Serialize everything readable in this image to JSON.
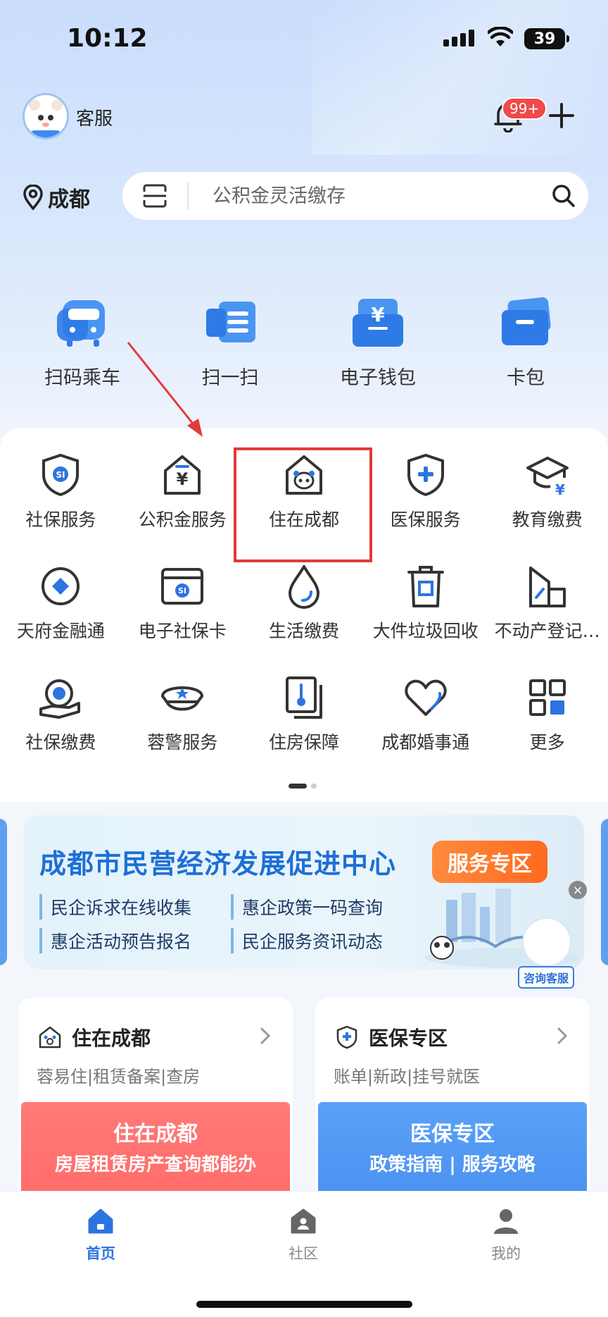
{
  "status_bar": {
    "time": "10:12",
    "battery": "39"
  },
  "header": {
    "service_label": "客服",
    "badge": "99+"
  },
  "location": {
    "city": "成都"
  },
  "search": {
    "placeholder": "公积金灵活缴存"
  },
  "quick_actions": [
    {
      "label": "扫码乘车",
      "icon": "bus-icon"
    },
    {
      "label": "扫一扫",
      "icon": "scan-icon"
    },
    {
      "label": "电子钱包",
      "icon": "wallet-icon"
    },
    {
      "label": "卡包",
      "icon": "card-icon"
    }
  ],
  "services": [
    {
      "label": "社保服务",
      "icon": "social-security-shield-icon"
    },
    {
      "label": "公积金服务",
      "icon": "housing-fund-house-icon"
    },
    {
      "label": "住在成都",
      "icon": "panda-house-icon"
    },
    {
      "label": "医保服务",
      "icon": "medical-shield-icon"
    },
    {
      "label": "教育缴费",
      "icon": "education-cap-icon"
    },
    {
      "label": "天府金融通",
      "icon": "diamond-circle-icon"
    },
    {
      "label": "电子社保卡",
      "icon": "social-card-icon"
    },
    {
      "label": "生活缴费",
      "icon": "water-drop-icon"
    },
    {
      "label": "大件垃圾回收",
      "icon": "trash-bin-icon"
    },
    {
      "label": "不动产登记…",
      "icon": "property-building-icon"
    },
    {
      "label": "社保缴费",
      "icon": "social-pay-icon"
    },
    {
      "label": "蓉警服务",
      "icon": "police-cap-icon"
    },
    {
      "label": "住房保障",
      "icon": "housing-thermometer-icon"
    },
    {
      "label": "成都婚事通",
      "icon": "heart-icon"
    },
    {
      "label": "更多",
      "icon": "more-grid-icon"
    }
  ],
  "banner": {
    "title": "成都市民营经济发展促进中心",
    "tag": "服务专区",
    "points": [
      "民企诉求在线收集",
      "惠企政策一码查询",
      "惠企活动预告报名",
      "民企服务资讯动态"
    ],
    "consult": "咨询客服",
    "close": "×"
  },
  "cards": {
    "left": {
      "title": "住在成都",
      "subtitle": "蓉易住|租赁备案|查房",
      "promo_line1": "住在成都",
      "promo_line2": "房屋租赁房产查询都能办"
    },
    "right": {
      "title": "医保专区",
      "subtitle": "账单|新政|挂号就医",
      "promo_line1": "医保专区",
      "promo_line2": "政策指南 | 服务攻略"
    }
  },
  "tabbar": [
    {
      "label": "首页",
      "active": true
    },
    {
      "label": "社区",
      "active": false
    },
    {
      "label": "我的",
      "active": false
    }
  ],
  "colors": {
    "accent": "#2d74e0",
    "highlight": "#e23a3a",
    "badge": "#f04a4a"
  }
}
